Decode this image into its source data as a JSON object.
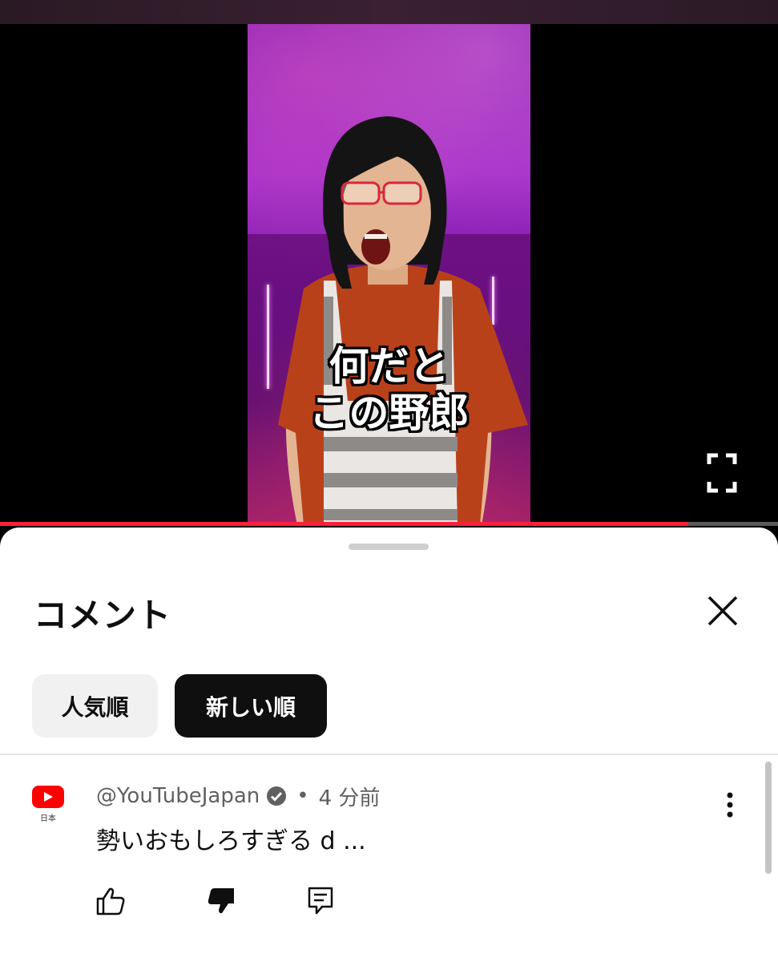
{
  "video": {
    "caption_line1": "何だと",
    "caption_line2": "この野郎",
    "progress_fraction": 0.885,
    "accent_color": "#ff1f3d"
  },
  "comments_panel": {
    "title": "コメント",
    "close_icon": "close-icon",
    "sort_chips": [
      {
        "label": "人気順",
        "selected": false
      },
      {
        "label": "新しい順",
        "selected": true
      }
    ]
  },
  "comment": {
    "author": "@YouTubeJapan",
    "verified": true,
    "separator": "•",
    "time": "4 分前",
    "avatar_sub": "日本",
    "text": "勢いおもしろすぎる d ...",
    "actions": [
      "thumbs-up-icon",
      "thumbs-down-icon",
      "reply-icon"
    ]
  }
}
